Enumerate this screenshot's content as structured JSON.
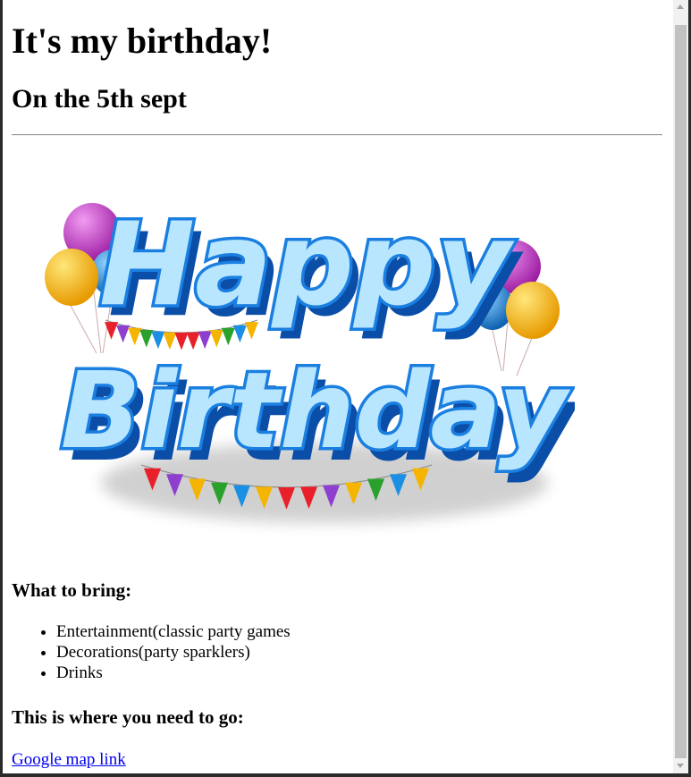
{
  "page": {
    "title": "It's my birthday!",
    "subtitle": "On the 5th sept"
  },
  "banner_image": {
    "line1": "Happy",
    "line2": "Birthday",
    "colors": {
      "text_fill": "#b9e6ff",
      "text_stroke": "#1a7fe0",
      "shadow": "#0b4ea8",
      "balloon_magenta": "#c23fc4",
      "balloon_yellow": "#f2b300",
      "balloon_blue": "#1f8ed8"
    },
    "bunting_colors": [
      "#e8202a",
      "#8e3fd0",
      "#f5b400",
      "#2aa12a",
      "#1a8fe3",
      "#f5b400",
      "#e8202a"
    ]
  },
  "bring": {
    "heading": "What to bring:",
    "items": [
      "Entertainment(classic party games",
      "Decorations(party sparklers)",
      "Drinks"
    ]
  },
  "directions": {
    "heading": "This is where you need to go:",
    "link_text": "Google map link"
  },
  "colors": {
    "link": "#0000ee",
    "background": "#ffffff",
    "scrollbar_thumb": "#c1c1c1"
  }
}
